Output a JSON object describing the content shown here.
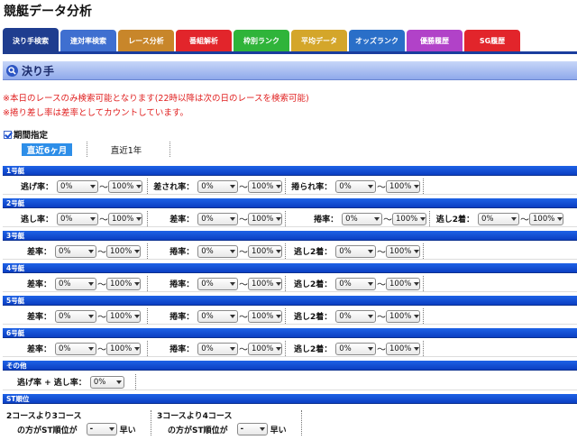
{
  "app": {
    "title": "競艇データ分析"
  },
  "tabs": [
    {
      "label": "決り手検索",
      "color": "#1f3d8f",
      "active": true
    },
    {
      "label": "連対率検索",
      "color": "#3f6fd0"
    },
    {
      "label": "レース分析",
      "color": "#c8862a"
    },
    {
      "label": "番組解析",
      "color": "#e2252b"
    },
    {
      "label": "枠別ランク",
      "color": "#2fb43a"
    },
    {
      "label": "平均データ",
      "color": "#d4a62a"
    },
    {
      "label": "オッズランク",
      "color": "#2a6fc8"
    },
    {
      "label": "優勝履歴",
      "color": "#b142c8"
    },
    {
      "label": "SG履歴",
      "color": "#e2252b"
    }
  ],
  "section": {
    "title": "決り手"
  },
  "notices": [
    "※本日のレースのみ検索可能となります(22時以降は次の日のレースを検索可能)",
    "※捲り差し率は差率としてカウントしています。"
  ],
  "period": {
    "label": "期間指定",
    "options": [
      "直近6ヶ月",
      "直近1年"
    ]
  },
  "defaults": {
    "from": "0%",
    "to": "100%",
    "tilde": "〜"
  },
  "boats": [
    {
      "header": "1号艇",
      "fields": [
        "逃げ率：",
        "差され率：",
        "捲られ率："
      ]
    },
    {
      "header": "2号艇",
      "fields": [
        "逃し率：",
        "差率：",
        "捲率：",
        "逃し2着："
      ]
    },
    {
      "header": "3号艇",
      "fields": [
        "差率：",
        "捲率：",
        "逃し2着："
      ]
    },
    {
      "header": "4号艇",
      "fields": [
        "差率：",
        "捲率：",
        "逃し2着："
      ]
    },
    {
      "header": "5号艇",
      "fields": [
        "差率：",
        "捲率：",
        "逃し2着："
      ]
    },
    {
      "header": "6号艇",
      "fields": [
        "差率：",
        "捲率：",
        "逃し2着："
      ]
    }
  ],
  "other": {
    "header": "その他",
    "label": "逃げ率 + 逃し率：",
    "value": "0%"
  },
  "st": {
    "header": "ST順位",
    "items": [
      {
        "line1": "2コースより3コース",
        "line2": "の方がST順位が",
        "value": "-",
        "suffix": "早い"
      },
      {
        "line1": "3コースより4コース",
        "line2": "の方がST順位が",
        "value": "-",
        "suffix": "早い"
      }
    ]
  }
}
